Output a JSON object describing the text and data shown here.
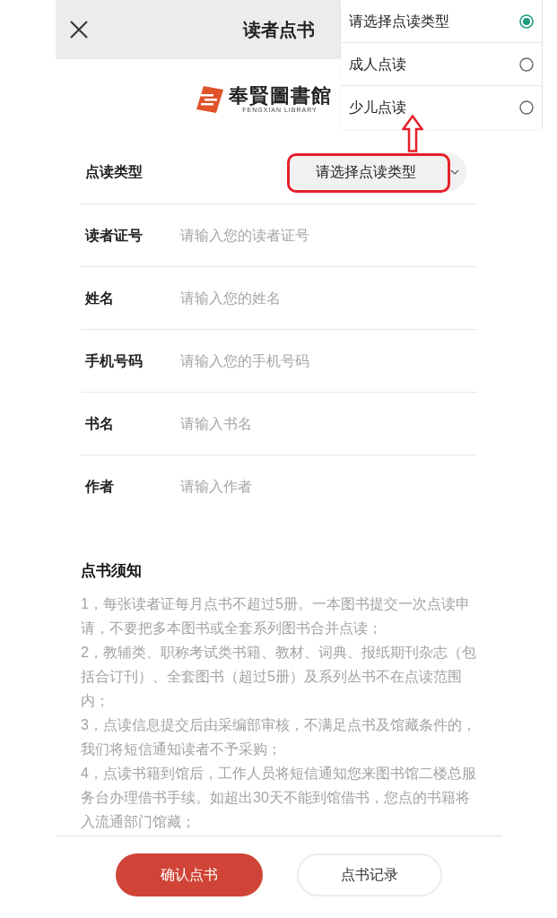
{
  "header": {
    "title": "读者点书"
  },
  "logo": {
    "name": "奉賢圖書館",
    "subtitle": "FENGXIAN LIBRARY"
  },
  "form": {
    "fields": [
      {
        "kind": "select",
        "label": "点读类型",
        "value": "请选择点读类型",
        "highlighted": true
      },
      {
        "kind": "input",
        "label": "读者证号",
        "placeholder": "请输入您的读者证号"
      },
      {
        "kind": "input",
        "label": "姓名",
        "placeholder": "请输入您的姓名"
      },
      {
        "kind": "input",
        "label": "手机号码",
        "placeholder": "请输入您的手机号码"
      },
      {
        "kind": "input",
        "label": "书名",
        "placeholder": "请输入书名"
      },
      {
        "kind": "input",
        "label": "作者",
        "placeholder": "请输入作者"
      }
    ]
  },
  "dropdown": {
    "options": [
      {
        "label": "请选择点读类型",
        "selected": true,
        "marked": false
      },
      {
        "label": "成人点读",
        "selected": false,
        "marked": false
      },
      {
        "label": "少儿点读",
        "selected": false,
        "marked": true
      }
    ]
  },
  "notice": {
    "title": "点书须知",
    "items": [
      "1，每张读者证每月点书不超过5册。一本图书提交一次点读申请，不要把多本图书或全套系列图书合并点读；",
      "2，教辅类、职称考试类书籍、教材、词典、报纸期刊杂志（包括合订刊）、全套图书（超过5册）及系列丛书不在点读范围内；",
      "3，点读信息提交后由采编部审核，不满足点书及馆藏条件的，我们将短信通知读者不予采购；",
      "4，点读书籍到馆后，工作人员将短信通知您来图书馆二楼总服务台办理借书手续。如超出30天不能到馆借书，您点的书籍将入流通部门馆藏；"
    ]
  },
  "buttons": [
    {
      "kind": "primary",
      "label": "确认点书"
    },
    {
      "kind": "secondary",
      "label": "点书记录"
    }
  ]
}
